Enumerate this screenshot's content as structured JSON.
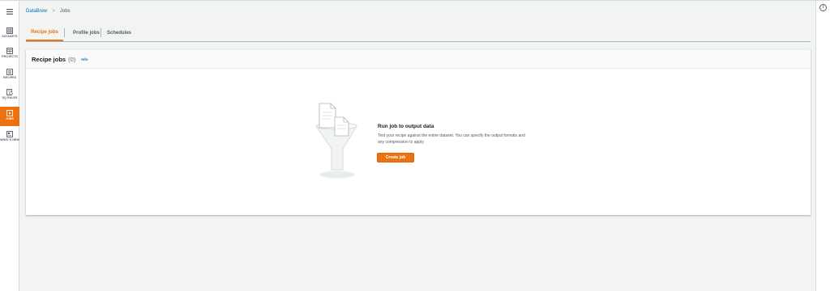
{
  "nav": {
    "items": [
      {
        "label": "DATASETS",
        "icon": "table-icon",
        "active": false
      },
      {
        "label": "PROJECTS",
        "icon": "grid-icon",
        "active": false
      },
      {
        "label": "RECIPES",
        "icon": "list-icon",
        "active": false
      },
      {
        "label": "DQ RULES",
        "icon": "dq-rules-icon",
        "active": false
      },
      {
        "label": "JOBS",
        "icon": "play-icon",
        "active": true
      },
      {
        "label": "WHAT'S NEW",
        "icon": "news-icon",
        "active": false
      }
    ],
    "accent": "#ec7211"
  },
  "breadcrumb": {
    "root": "DataBrew",
    "separator": ">",
    "current": "Jobs"
  },
  "tabs": [
    {
      "label": "Recipe jobs",
      "active": true
    },
    {
      "label": "Profile jobs",
      "active": false
    },
    {
      "label": "Schedules",
      "active": false
    }
  ],
  "panel": {
    "title": "Recipe jobs",
    "count": "(0)",
    "info": "Info",
    "empty": {
      "title": "Run job to output data",
      "description": "Test your recipe against the entire dataset. You can specify the output formats and any compression to apply.",
      "button": "Create job"
    }
  },
  "colors": {
    "link": "#0073bb",
    "primary": "#ec7211",
    "background": "#f2f3f3"
  }
}
